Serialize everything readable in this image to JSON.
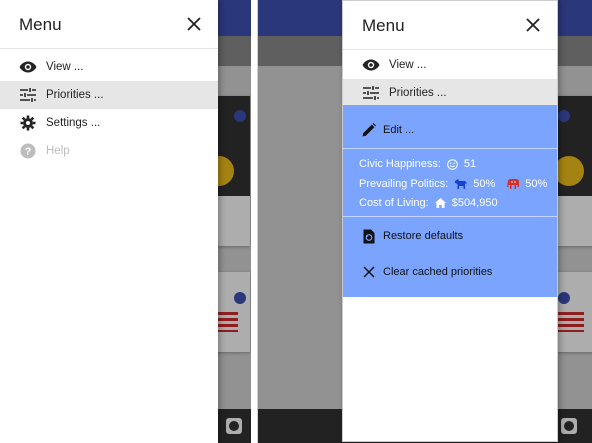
{
  "menu": {
    "title": "Menu",
    "items": [
      {
        "label": "View ...",
        "icon": "eye-icon"
      },
      {
        "label": "Priorities ...",
        "icon": "sliders-icon"
      },
      {
        "label": "Settings ...",
        "icon": "gear-icon"
      },
      {
        "label": "Help",
        "icon": "help-circle-icon",
        "disabled": true
      }
    ]
  },
  "priorities_submenu": {
    "edit_label": "Edit ...",
    "civic_happiness_label": "Civic Happiness:",
    "civic_happiness_value": "51",
    "prevailing_politics_label": "Prevailing Politics:",
    "democrat_pct": "50%",
    "republican_pct": "50%",
    "cost_of_living_label": "Cost of Living:",
    "cost_of_living_value": "$504,950",
    "restore_label": "Restore defaults",
    "clear_label": "Clear cached priorities"
  },
  "colors": {
    "app_bar": "#3f51b5",
    "submenu_bg": "#7ba4ff",
    "democrat": "#1a3fd6",
    "republican": "#d32f2f"
  }
}
